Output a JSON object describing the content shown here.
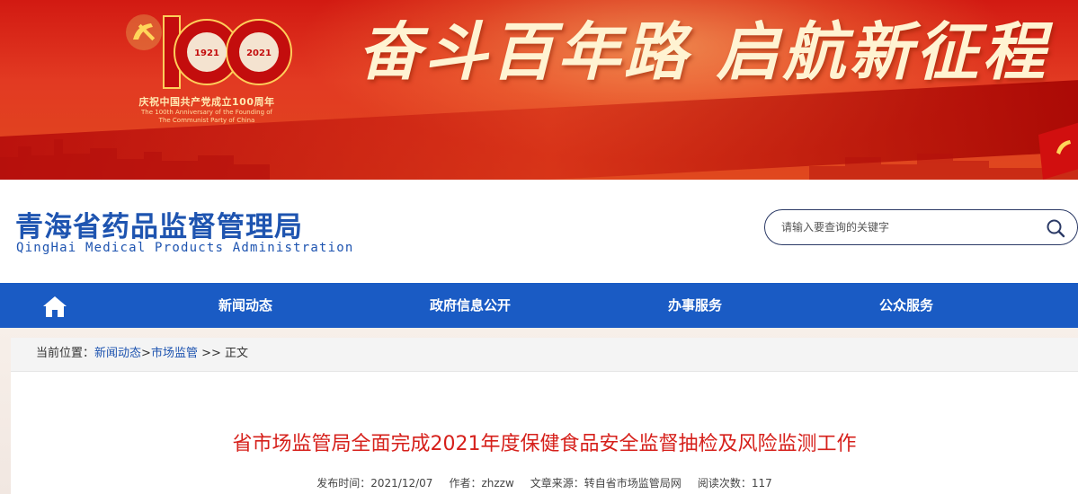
{
  "banner": {
    "logo_years": [
      "1921",
      "2021"
    ],
    "anniversary_cn": "庆祝中国共产党成立100周年",
    "anniversary_en": [
      "The 100th Anniversary of the Founding of",
      "The Communist Party of China"
    ],
    "slogan": "奋斗百年路 启航新征程"
  },
  "header": {
    "title": "青海省药品监督管理局",
    "subtitle": "QingHai Medical Products Administration",
    "search_placeholder": "请输入要查询的关键字"
  },
  "nav": {
    "items": [
      "新闻动态",
      "政府信息公开",
      "办事服务",
      "公众服务"
    ]
  },
  "breadcrumb": {
    "prefix": "当前位置：",
    "link1": "新闻动态",
    "sep1": ">",
    "link2": "市场监管",
    "sep2": " >> ",
    "current": "正文"
  },
  "article": {
    "title": "省市场监管局全面完成2021年度保健食品安全监督抽检及风险监测工作",
    "meta": {
      "date_label": "发布时间：",
      "date": "2021/12/07",
      "author_label": "作者：",
      "author": "zhzzw",
      "source_label": "文章来源：",
      "source": "转自省市场监管局网",
      "views_label": "阅读次数：",
      "views": "117"
    }
  },
  "colors": {
    "nav_blue": "#1a5bc4",
    "title_blue": "#1e54b0",
    "article_red": "#d6201b",
    "banner_red": "#d21a12"
  }
}
